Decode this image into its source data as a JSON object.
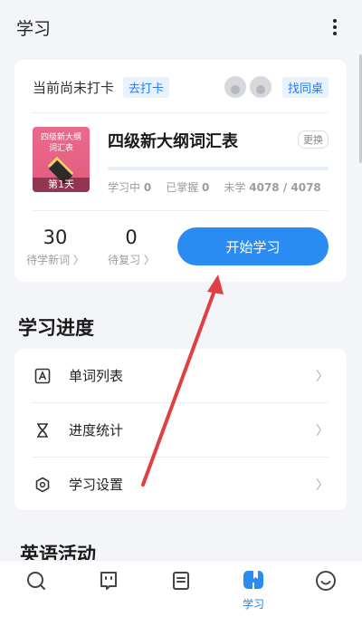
{
  "header": {
    "title": "学习",
    "more_icon": "more-vertical-icon"
  },
  "checkin": {
    "status": "当前尚未打卡",
    "action": "去打卡",
    "find_desk": "找同桌"
  },
  "book": {
    "cover_title": "四级新大纲\n词汇表",
    "cover_day": "第1天",
    "name": "四级新大纲词汇表",
    "change": "更换",
    "progress": 0,
    "stats": {
      "learning_label": "学习中",
      "learning_value": "0",
      "mastered_label": "已掌握",
      "mastered_value": "0",
      "unlearned_label": "未学",
      "unlearned_value": "4078 / 4078"
    }
  },
  "counts": {
    "new_value": "30",
    "new_label": "待学新词 〉",
    "review_value": "0",
    "review_label": "待复习 〉"
  },
  "start_button": "开始学习",
  "progress_section": {
    "title": "学习进度",
    "items": [
      {
        "label": "单词列表",
        "icon": "word-list-icon"
      },
      {
        "label": "进度统计",
        "icon": "hourglass-icon"
      },
      {
        "label": "学习设置",
        "icon": "settings-hexagon-icon"
      }
    ]
  },
  "activities_section": {
    "title": "英语活动"
  },
  "tabbar": {
    "tabs": [
      {
        "icon": "search-icon",
        "label": ""
      },
      {
        "icon": "chat-face-icon",
        "label": ""
      },
      {
        "icon": "notes-icon",
        "label": ""
      },
      {
        "icon": "book-icon",
        "label": "学习",
        "active": true
      },
      {
        "icon": "smiley-icon",
        "label": ""
      }
    ]
  },
  "colors": {
    "accent": "#2a8bf2",
    "annotation_arrow": "#e04040"
  }
}
